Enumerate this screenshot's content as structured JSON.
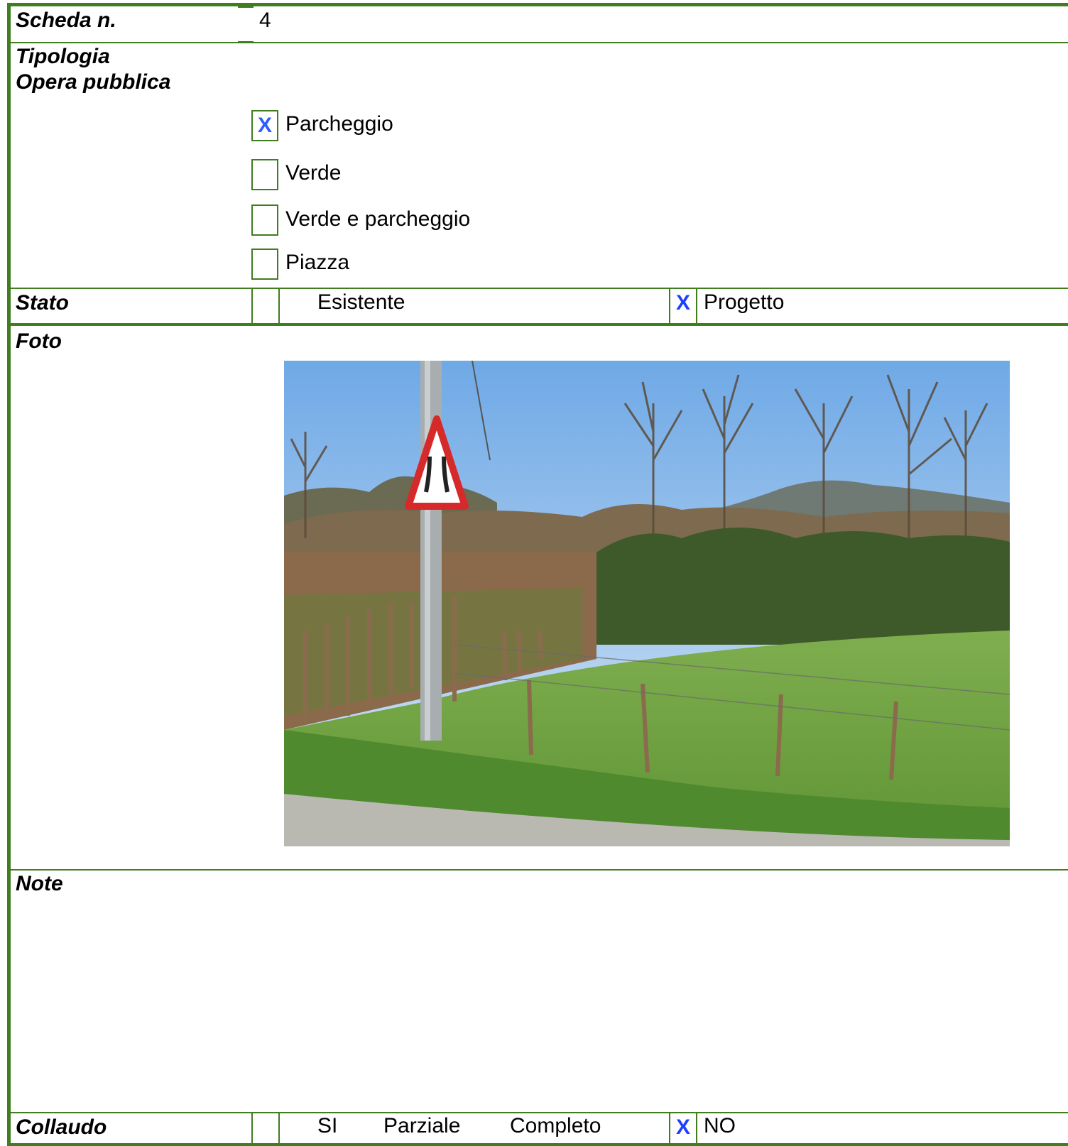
{
  "scheda": {
    "label": "Scheda n.",
    "value": "4"
  },
  "tipologia": {
    "label_line1": "Tipologia",
    "label_line2": "Opera pubblica",
    "options": [
      {
        "label": "Parcheggio",
        "checked": true,
        "mark": "X"
      },
      {
        "label": "Verde",
        "checked": false,
        "mark": ""
      },
      {
        "label": "Verde e parcheggio",
        "checked": false,
        "mark": ""
      },
      {
        "label": "Piazza",
        "checked": false,
        "mark": ""
      }
    ]
  },
  "stato": {
    "label": "Stato",
    "option_esistente": "Esistente",
    "option_progetto": "Progetto",
    "progetto_mark": "X"
  },
  "foto": {
    "label": "Foto"
  },
  "note": {
    "label": "Note"
  },
  "collaudo": {
    "label": "Collaudo",
    "si": "SI",
    "parziale": "Parziale",
    "completo": "Completo",
    "no": "NO",
    "no_mark": "X"
  },
  "colors": {
    "border": "#3f7d1f",
    "mark": "#1f3fff"
  },
  "photo": {
    "subject": "roadside field with narrowing-road warning sign, fence, trees and hills"
  }
}
